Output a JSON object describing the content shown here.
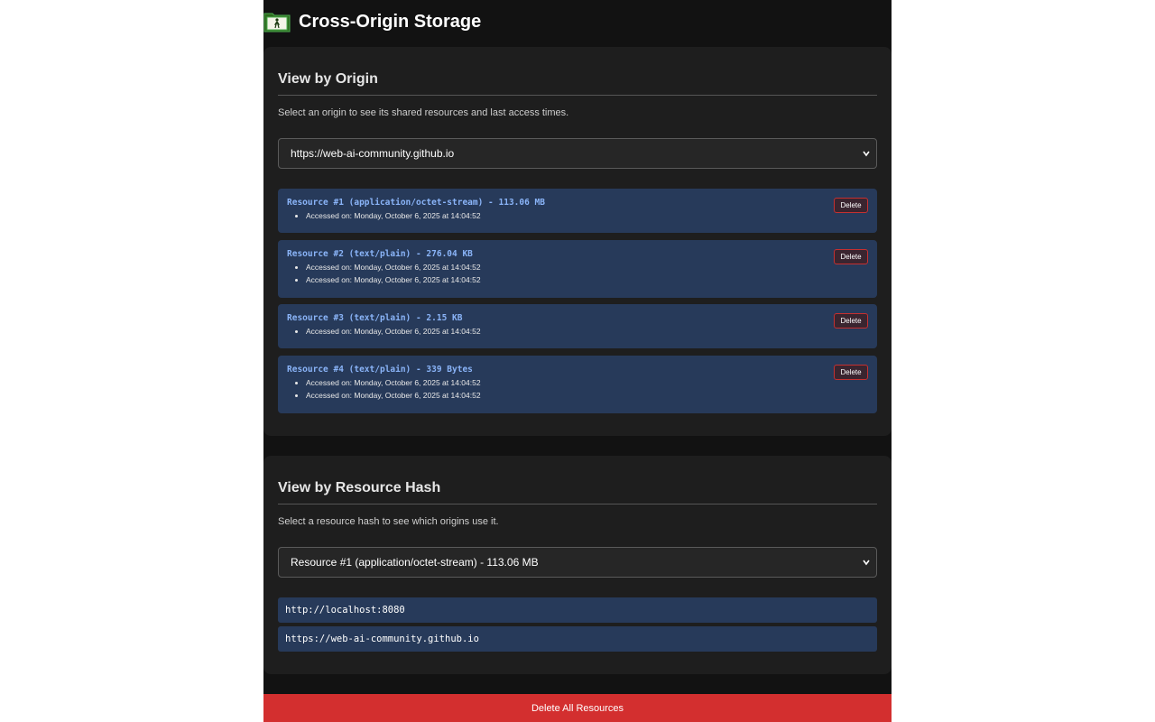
{
  "header": {
    "title": "Cross-Origin Storage",
    "icon": "folder-person-icon"
  },
  "origin_view": {
    "heading": "View by Origin",
    "description": "Select an origin to see its shared resources and last access times.",
    "selected_origin": "https://web-ai-community.github.io",
    "delete_label": "Delete",
    "resources": [
      {
        "title": "Resource #1 (application/octet-stream) - 113.06 MB",
        "accesses": [
          "Accessed on: Monday, October 6, 2025 at 14:04:52"
        ]
      },
      {
        "title": "Resource #2 (text/plain) - 276.04 KB",
        "accesses": [
          "Accessed on: Monday, October 6, 2025 at 14:04:52",
          "Accessed on: Monday, October 6, 2025 at 14:04:52"
        ]
      },
      {
        "title": "Resource #3 (text/plain) - 2.15 KB",
        "accesses": [
          "Accessed on: Monday, October 6, 2025 at 14:04:52"
        ]
      },
      {
        "title": "Resource #4 (text/plain) - 339 Bytes",
        "accesses": [
          "Accessed on: Monday, October 6, 2025 at 14:04:52",
          "Accessed on: Monday, October 6, 2025 at 14:04:52"
        ]
      }
    ]
  },
  "hash_view": {
    "heading": "View by Resource Hash",
    "description": "Select a resource hash to see which origins use it.",
    "selected_resource": "Resource #1 (application/octet-stream) - 113.06 MB",
    "origins": [
      "http://localhost:8080",
      "https://web-ai-community.github.io"
    ]
  },
  "footer": {
    "delete_all_label": "Delete All Resources"
  },
  "colors": {
    "page_bg": "#121212",
    "card_bg": "#1e1e1e",
    "resource_bg": "#273a5a",
    "resource_title": "#8ab4f8",
    "danger": "#d32f2f",
    "icon_green": "#4caf50"
  }
}
